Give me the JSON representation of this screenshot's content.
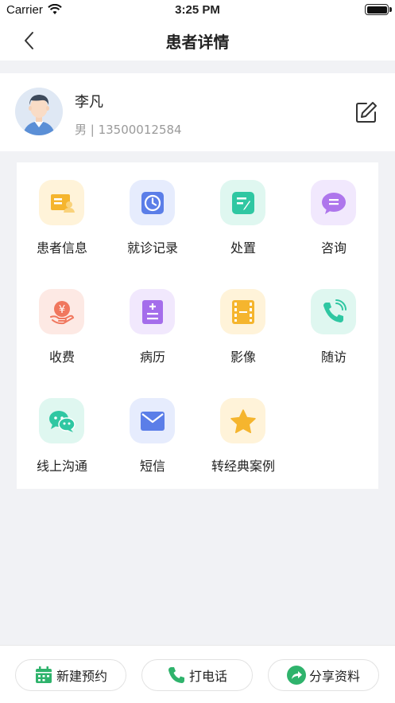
{
  "status_bar": {
    "carrier": "Carrier",
    "time": "3:25 PM"
  },
  "nav": {
    "title": "患者详情",
    "back_icon": "chevron-left-icon"
  },
  "patient": {
    "name": "李凡",
    "meta": "男 | 13500012584",
    "edit_icon": "edit-icon"
  },
  "menu": [
    {
      "label": "患者信息",
      "icon": "id-card-icon",
      "tile_color": "#fff3d9",
      "icon_color": "#f5b52e"
    },
    {
      "label": "就诊记录",
      "icon": "clock-icon",
      "tile_color": "#e6ecfd",
      "icon_color": "#5b7ee8"
    },
    {
      "label": "处置",
      "icon": "note-edit-icon",
      "tile_color": "#dff7f0",
      "icon_color": "#2fc7a2"
    },
    {
      "label": "咨询",
      "icon": "chat-bubble-icon",
      "tile_color": "#f1e8fd",
      "icon_color": "#ae76ec"
    },
    {
      "label": "收费",
      "icon": "yuan-hand-icon",
      "tile_color": "#fde9e4",
      "icon_color": "#f0775e"
    },
    {
      "label": "病历",
      "icon": "medical-record-icon",
      "tile_color": "#f1e8fd",
      "icon_color": "#a46deb"
    },
    {
      "label": "影像",
      "icon": "film-icon",
      "tile_color": "#fff3d9",
      "icon_color": "#f5b52e"
    },
    {
      "label": "随访",
      "icon": "phone-call-icon",
      "tile_color": "#dff7f0",
      "icon_color": "#2fc7a2"
    },
    {
      "label": "线上沟通",
      "icon": "wechat-icon",
      "tile_color": "#dff7f0",
      "icon_color": "#2fc7a2"
    },
    {
      "label": "短信",
      "icon": "envelope-icon",
      "tile_color": "#e6ecfd",
      "icon_color": "#5b7ee8"
    },
    {
      "label": "转经典案例",
      "icon": "star-icon",
      "tile_color": "#fff3d9",
      "icon_color": "#f5b52e"
    }
  ],
  "bottom_actions": [
    {
      "label": "新建预约",
      "icon": "calendar-icon",
      "color": "#2fb36c"
    },
    {
      "label": "打电话",
      "icon": "phone-icon",
      "color": "#2fb36c"
    },
    {
      "label": "分享资料",
      "icon": "share-arrow-icon",
      "color": "#2fb36c"
    }
  ]
}
